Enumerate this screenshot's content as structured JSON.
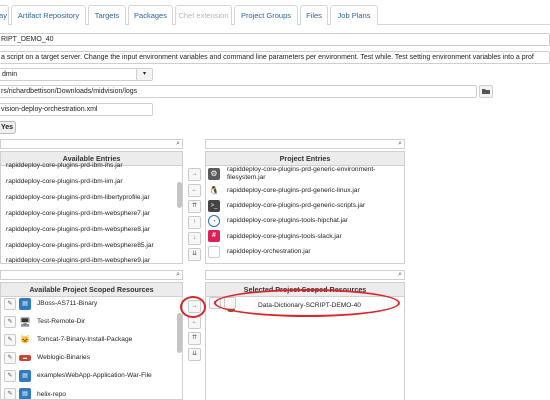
{
  "tabs": [
    {
      "label": "Bay"
    },
    {
      "label": "Artifact Repository"
    },
    {
      "label": "Targets"
    },
    {
      "label": "Packages"
    },
    {
      "label": "Chef extension",
      "disabled": true
    },
    {
      "label": "Project Groups"
    },
    {
      "label": "Files"
    },
    {
      "label": "Job Plans"
    }
  ],
  "form": {
    "name_value": "RIPT_DEMO_40",
    "description_value": "a script on a target server. Change the input environment variables and command line parameters per environment. Test while. Test setting environment variables into a prof",
    "user_value": "dmin",
    "user_caret": "▾",
    "path_value": "rs/richardbettison/Downloads/midvision/logs",
    "browse_icon": "folder-icon",
    "file_value": "vision-deploy-orchestration.xml",
    "yes_label": "Yes"
  },
  "available_entries": {
    "title": "Available Entries",
    "items": [
      "rapiddeploy-core-plugins-prd-ibm-ihs.jar",
      "rapiddeploy-core-plugins-prd-ibm-iim.jar",
      "rapiddeploy-core-plugins-prd-ibm-libertyprofile.jar",
      "rapiddeploy-core-plugins-prd-ibm-websphere7.jar",
      "rapiddeploy-core-plugins-prd-ibm-websphere8.jar",
      "rapiddeploy-core-plugins-prd-ibm-websphere85.jar",
      "rapiddeploy-core-plugins-prd-ibm-websphere9.jar"
    ]
  },
  "project_entries": {
    "title": "Project Entries",
    "items": [
      {
        "label": "rapiddeploy-core-plugins-prd-generic-environment-filesystem.jar",
        "icon": "gear-icon",
        "icon_color": "#5a5a5a"
      },
      {
        "label": "rapiddeploy-core-plugins-prd-generic-linux.jar",
        "icon": "penguin-icon",
        "icon_color": "#222222"
      },
      {
        "label": "rapiddeploy-core-plugins-prd-generic-scripts.jar",
        "icon": "terminal-icon",
        "icon_color": "#444444"
      },
      {
        "label": "rapiddeploy-core-plugins-tools-hipchat.jar",
        "icon": "chat-icon",
        "icon_color": "#2b6fb6"
      },
      {
        "label": "rapiddeploy-core-plugins-tools-slack.jar",
        "icon": "slack-icon",
        "icon_color": "#e01e5a"
      },
      {
        "label": "rapiddeploy-orchestration.jar",
        "icon": "plain-icon",
        "icon_color": "#ffffff"
      }
    ]
  },
  "movers": {
    "right": "→",
    "left": "←",
    "top": "⇈",
    "up": "↑",
    "down": "↓",
    "bottom": "⇊"
  },
  "available_resources": {
    "title": "Available Project Scoped Resources",
    "edit_icon": "✎",
    "items": [
      {
        "label": "JBoss-AS711-Binary",
        "icon": "server-icon"
      },
      {
        "label": "Test-Remote-Dir",
        "icon": "monitor-icon"
      },
      {
        "label": "Tomcat-7-Binary-Install-Package",
        "icon": "tomcat-icon"
      },
      {
        "label": "Weblogic-Binaries",
        "icon": "oracle-icon"
      },
      {
        "label": "examplesWebApp-Application-War-File",
        "icon": "server-icon"
      },
      {
        "label": "helix-repo",
        "icon": "server-icon"
      }
    ]
  },
  "selected_resources": {
    "title": "Selected Project Scoped Resources",
    "items": [
      {
        "label": "Data-Dictionary-SCRIPT-DEMO-40",
        "icon": "database-icon"
      }
    ]
  },
  "search_glyph": "⌕",
  "highlight_color": "#d9262a",
  "link_color": "#2a6496"
}
